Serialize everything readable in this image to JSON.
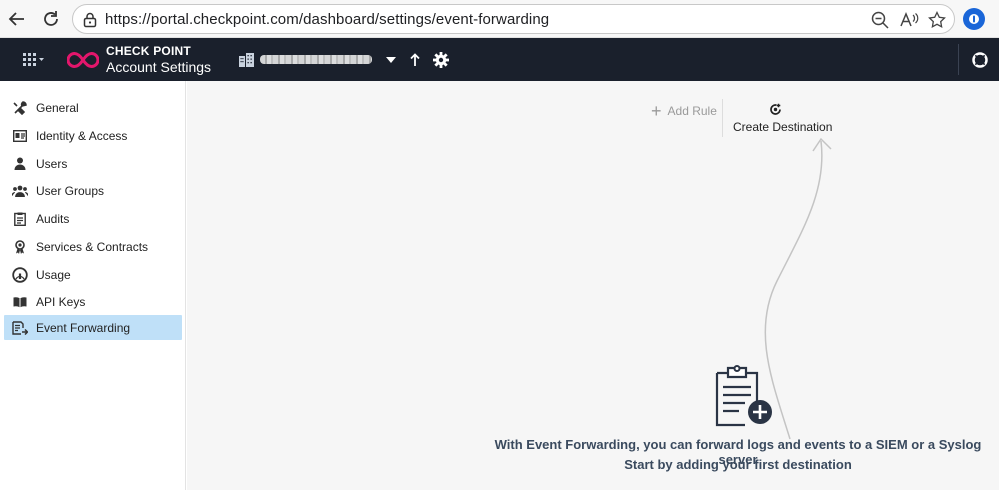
{
  "browser": {
    "url": "https://portal.checkpoint.com/dashboard/settings/event-forwarding"
  },
  "header": {
    "brand_top": "CHECK POINT",
    "brand_bottom": "Account Settings",
    "accent_color": "#e3166c"
  },
  "sidebar": {
    "items": [
      {
        "label": "General",
        "icon": "tools-icon"
      },
      {
        "label": "Identity & Access",
        "icon": "id-card-icon"
      },
      {
        "label": "Users",
        "icon": "user-icon"
      },
      {
        "label": "User Groups",
        "icon": "users-icon"
      },
      {
        "label": "Audits",
        "icon": "clipboard-icon"
      },
      {
        "label": "Services & Contracts",
        "icon": "ribbon-icon"
      },
      {
        "label": "Usage",
        "icon": "gauge-icon"
      },
      {
        "label": "API Keys",
        "icon": "book-icon"
      },
      {
        "label": "Event Forwarding",
        "icon": "forward-doc-icon",
        "active": true
      }
    ],
    "active_color": "#bfe0f8"
  },
  "toolbar": {
    "add_rule": "Add Rule",
    "create_destination": "Create Destination"
  },
  "empty_state": {
    "line1": "With Event Forwarding, you can forward logs and events to a SIEM or a Syslog server",
    "line2": "Start by adding your first destination"
  }
}
